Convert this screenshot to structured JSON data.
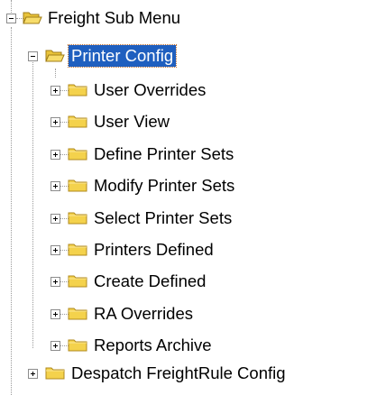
{
  "tree": {
    "root": {
      "label": "Freight Sub Menu",
      "state": "expanded",
      "icon": "open-folder-icon"
    },
    "selected": {
      "label": "Printer Config",
      "state": "expanded",
      "icon": "open-folder-icon"
    },
    "children": [
      {
        "label": "User Overrides",
        "state": "collapsed",
        "icon": "folder-icon"
      },
      {
        "label": "User View",
        "state": "collapsed",
        "icon": "folder-icon"
      },
      {
        "label": "Define Printer Sets",
        "state": "collapsed",
        "icon": "folder-icon"
      },
      {
        "label": "Modify Printer Sets",
        "state": "collapsed",
        "icon": "folder-icon"
      },
      {
        "label": "Select Printer Sets",
        "state": "collapsed",
        "icon": "folder-icon"
      },
      {
        "label": "Printers Defined",
        "state": "collapsed",
        "icon": "folder-icon"
      },
      {
        "label": "Create Defined",
        "state": "collapsed",
        "icon": "folder-icon"
      },
      {
        "label": "RA Overrides",
        "state": "collapsed",
        "icon": "folder-icon"
      },
      {
        "label": "Reports Archive",
        "state": "collapsed",
        "icon": "folder-icon"
      }
    ],
    "sibling": {
      "label": "Despatch FreightRule Config",
      "state": "collapsed",
      "icon": "folder-icon"
    }
  },
  "colors": {
    "selection_bg": "#1f5fbf",
    "selection_text": "#ffffff",
    "folder_fill": "#f4d24c",
    "folder_edge": "#b08a1c"
  }
}
